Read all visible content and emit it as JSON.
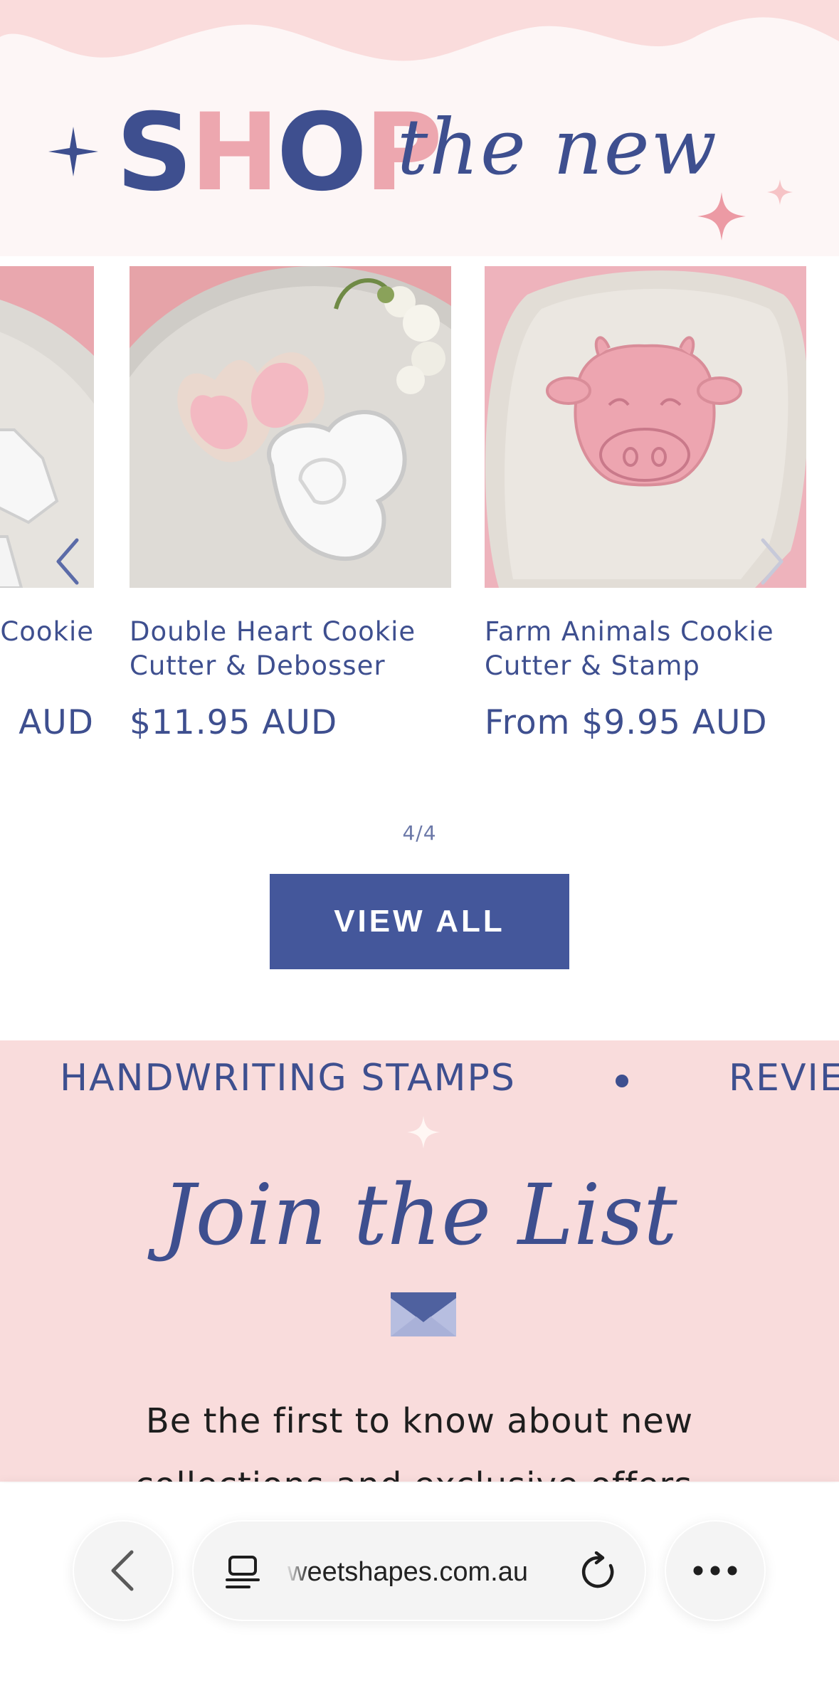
{
  "hero": {
    "shop_word": [
      "S",
      "H",
      "O",
      "P"
    ],
    "script_text": "the new"
  },
  "products": [
    {
      "name_lines": [
        "Cookie",
        ""
      ],
      "price": "AUD",
      "image": "unicorn-cutter-photo"
    },
    {
      "name_lines": [
        "Double Heart Cookie",
        "Cutter & Debosser"
      ],
      "price": "$11.95 AUD",
      "image": "double-heart-cutter-photo"
    },
    {
      "name_lines": [
        "Farm Animals Cookie",
        "Cutter & Stamp"
      ],
      "price": "From $9.95 AUD",
      "image": "cow-stamp-photo"
    }
  ],
  "carousel": {
    "counter": "4/4",
    "prev_icon": "chevron-left-icon",
    "next_icon": "chevron-right-icon"
  },
  "view_all_label": "VIEW ALL",
  "marquee": {
    "item_1": "HANDWRITING STAMPS",
    "item_2": "REVIE"
  },
  "join": {
    "title": "Join the List",
    "line_1": "Be the first to know about new",
    "line_2": "collections and exclusive offers."
  },
  "browser": {
    "url": "weetshapes.com.au",
    "back_icon": "chevron-left-icon",
    "tab_icon": "tab-overview-icon",
    "reload_icon": "reload-icon",
    "more_icon": "more-dots-icon"
  },
  "colors": {
    "brand_blue": "#44579b",
    "brand_pink": "#eda7af",
    "section_pink": "#f9dcdc"
  }
}
